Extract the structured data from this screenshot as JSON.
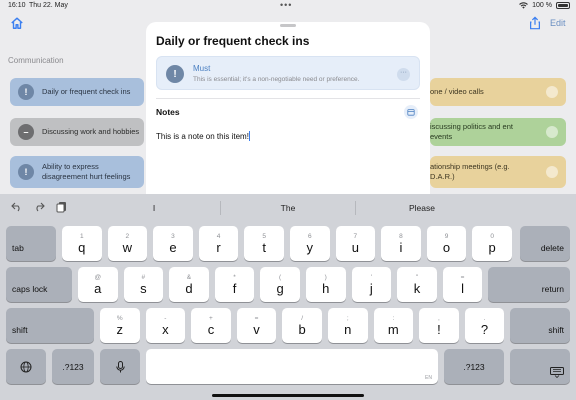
{
  "status": {
    "time": "16:10",
    "date": "Thu 22. May",
    "battery": "100 %",
    "dots": "•••"
  },
  "background": {
    "edit_label": "Edit",
    "section_title": "Communication",
    "cards": [
      {
        "label": "Daily or frequent check ins",
        "color": "blue",
        "icon": "!"
      },
      {
        "label": "Discussing work and hobbies",
        "color": "gray",
        "icon": "–"
      },
      {
        "label": "Ability to express disagreement hurt feelings",
        "color": "blue",
        "icon": "!"
      },
      {
        "label": "one / video calls",
        "color": "yellow"
      },
      {
        "label": "iscussing politics and ent events",
        "color": "green"
      },
      {
        "label": "ationship meetings (e.g. D.A.R.)",
        "color": "yellow"
      }
    ]
  },
  "modal": {
    "title": "Daily or frequent check ins",
    "priority": {
      "title": "Must",
      "description": "This is essential; it's a non-negotiable need or preference.",
      "icon": "!"
    },
    "notes_label": "Notes",
    "notes_text": "This is a note on this item!"
  },
  "keyboard": {
    "suggestions": [
      "I",
      "The",
      "Please"
    ],
    "row1": [
      {
        "main": "q",
        "alt": "1"
      },
      {
        "main": "w",
        "alt": "2"
      },
      {
        "main": "e",
        "alt": "3"
      },
      {
        "main": "r",
        "alt": "4"
      },
      {
        "main": "t",
        "alt": "5"
      },
      {
        "main": "y",
        "alt": "6"
      },
      {
        "main": "u",
        "alt": "7"
      },
      {
        "main": "i",
        "alt": "8"
      },
      {
        "main": "o",
        "alt": "9"
      },
      {
        "main": "p",
        "alt": "0"
      }
    ],
    "row2": [
      {
        "main": "a",
        "alt": "@"
      },
      {
        "main": "s",
        "alt": "#"
      },
      {
        "main": "d",
        "alt": "&"
      },
      {
        "main": "f",
        "alt": "*"
      },
      {
        "main": "g",
        "alt": "("
      },
      {
        "main": "h",
        "alt": ")"
      },
      {
        "main": "j",
        "alt": "'"
      },
      {
        "main": "k",
        "alt": "\""
      },
      {
        "main": "l",
        "alt": "="
      }
    ],
    "row3": [
      {
        "main": "z",
        "alt": "%"
      },
      {
        "main": "x",
        "alt": "-"
      },
      {
        "main": "c",
        "alt": "+"
      },
      {
        "main": "v",
        "alt": "="
      },
      {
        "main": "b",
        "alt": "/"
      },
      {
        "main": "n",
        "alt": ";"
      },
      {
        "main": "m",
        "alt": ":"
      },
      {
        "main": "!",
        "alt": ","
      },
      {
        "main": "?",
        "alt": "."
      }
    ],
    "tab": "tab",
    "delete": "delete",
    "caps": "caps lock",
    "return": "return",
    "shift": "shift",
    "numbers": ".?123",
    "space_hint": "EN"
  }
}
